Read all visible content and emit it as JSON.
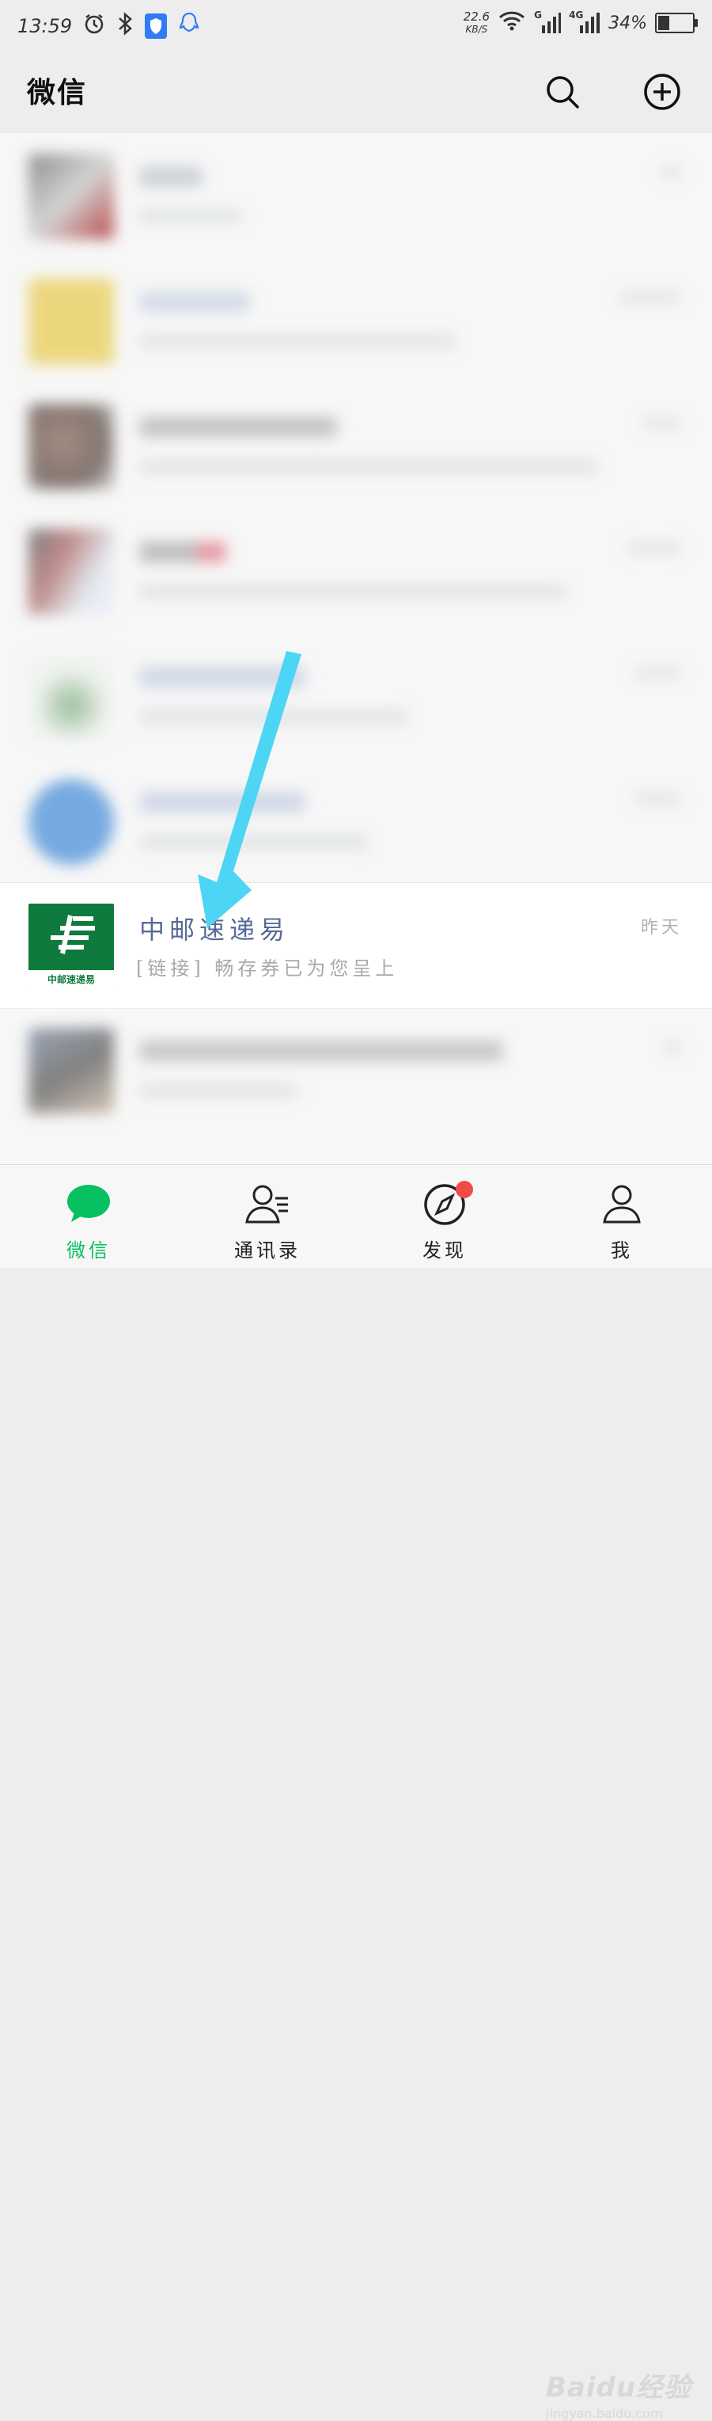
{
  "status_bar": {
    "time": "13:59",
    "speed_value": "22.6",
    "speed_unit": "KB/S",
    "signal1_label": "G",
    "signal2_label": "4G",
    "battery_text": "34%",
    "battery_level": 0.34
  },
  "header": {
    "title": "微信"
  },
  "chat_list": {
    "highlighted": {
      "name": "中邮速递易",
      "message": "[链接] 畅存券已为您呈上",
      "time": "昨天",
      "logo_text": "中邮速递易"
    }
  },
  "tab_bar": {
    "tabs": [
      {
        "label": "微信",
        "active": true
      },
      {
        "label": "通讯录",
        "active": false
      },
      {
        "label": "发现",
        "active": false
      },
      {
        "label": "我",
        "active": false
      }
    ]
  },
  "colors": {
    "accent_green": "#07c160",
    "name_blue": "#576b95",
    "arrow_cyan": "#4dd5f5",
    "badge_red": "#f04b4b"
  },
  "watermark": {
    "brand": "Baidu经验",
    "url": "jingyan.baidu.com"
  }
}
